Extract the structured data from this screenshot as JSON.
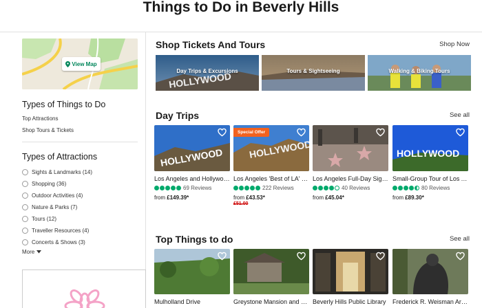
{
  "page": {
    "title": "Things to Do in Beverly Hills"
  },
  "sidebar": {
    "map_button": "View Map",
    "types_things": {
      "heading": "Types of Things to Do",
      "links": [
        "Top Attractions",
        "Shop Tours & Tickets"
      ]
    },
    "types_attractions": {
      "heading": "Types of Attractions",
      "items": [
        "Sights & Landmarks (14)",
        "Shopping (36)",
        "Outdoor Activities (4)",
        "Nature & Parks (7)",
        "Tours (12)",
        "Traveller Resources (4)",
        "Concerts & Shows (3)"
      ]
    },
    "more_label": "More"
  },
  "shop": {
    "title": "Shop Tickets And Tours",
    "link": "Shop Now",
    "tiles": [
      "Day Trips & Excursions",
      "Tours & Sightseeing",
      "Walking & Biking Tours"
    ]
  },
  "day_trips": {
    "title": "Day Trips",
    "link": "See all",
    "cards": [
      {
        "title": "Los Angeles and Hollywood Tour",
        "rating": 5,
        "reviews": "69 Reviews",
        "price_prefix": "from ",
        "price": "£149.39*",
        "old_price": "",
        "badge": ""
      },
      {
        "title": "Los Angeles 'Best of LA' Tour",
        "rating": 5,
        "reviews": "222 Reviews",
        "price_prefix": "from ",
        "price": "£43.53*",
        "old_price": "£51.00",
        "badge": "Special Offer"
      },
      {
        "title": "Los Angeles Full-Day Sightseeing",
        "rating": 4,
        "reviews": "40 Reviews",
        "price_prefix": "from ",
        "price": "£45.04*",
        "old_price": "",
        "badge": ""
      },
      {
        "title": "Small-Group Tour of Los Angeles",
        "rating": 4.5,
        "reviews": "80 Reviews",
        "price_prefix": "from ",
        "price": "£89.30*",
        "old_price": "",
        "badge": ""
      }
    ]
  },
  "top_things": {
    "title": "Top Things to do",
    "link": "See all",
    "cards": [
      {
        "title": "Mulholland Drive"
      },
      {
        "title": "Greystone Mansion and Gardens"
      },
      {
        "title": "Beverly Hills Public Library"
      },
      {
        "title": "Frederick R. Weisman Art Foundation"
      }
    ]
  },
  "colors": {
    "rating": "#00aa6c",
    "badge": "#f2621f",
    "map_link": "#00865a",
    "old_price": "#cc0000"
  }
}
